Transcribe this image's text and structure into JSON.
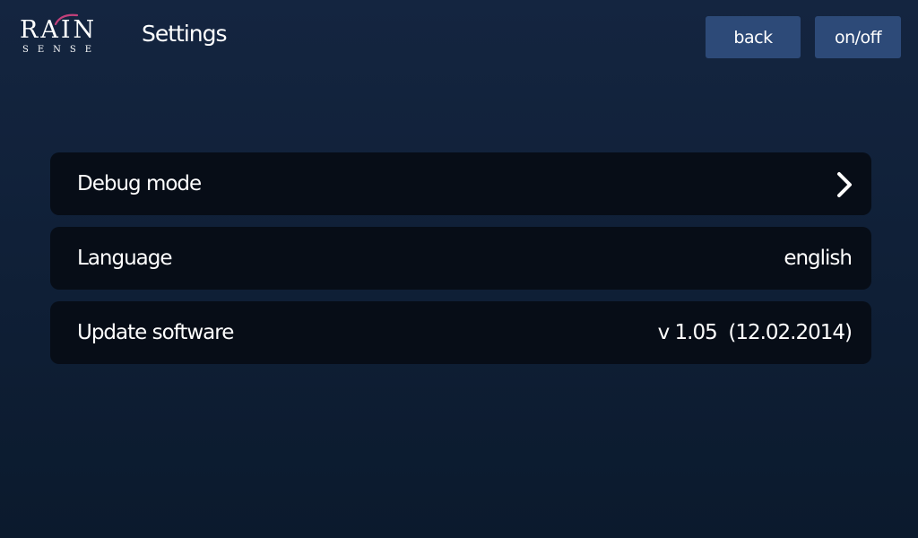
{
  "brand": {
    "main": "RAIN",
    "sub": "SENSE"
  },
  "header": {
    "title": "Settings",
    "back_label": "back",
    "power_label": "on/off"
  },
  "settings": [
    {
      "label": "Debug mode",
      "value": "",
      "icon": "chevron-right-icon"
    },
    {
      "label": "Language",
      "value": "english"
    },
    {
      "label": "Update software",
      "value": "v 1.05  (12.02.2014)"
    }
  ],
  "colors": {
    "background": "#142540",
    "button": "#2d4a78",
    "row": "#070d17",
    "logo_accent": "#c2407a"
  }
}
